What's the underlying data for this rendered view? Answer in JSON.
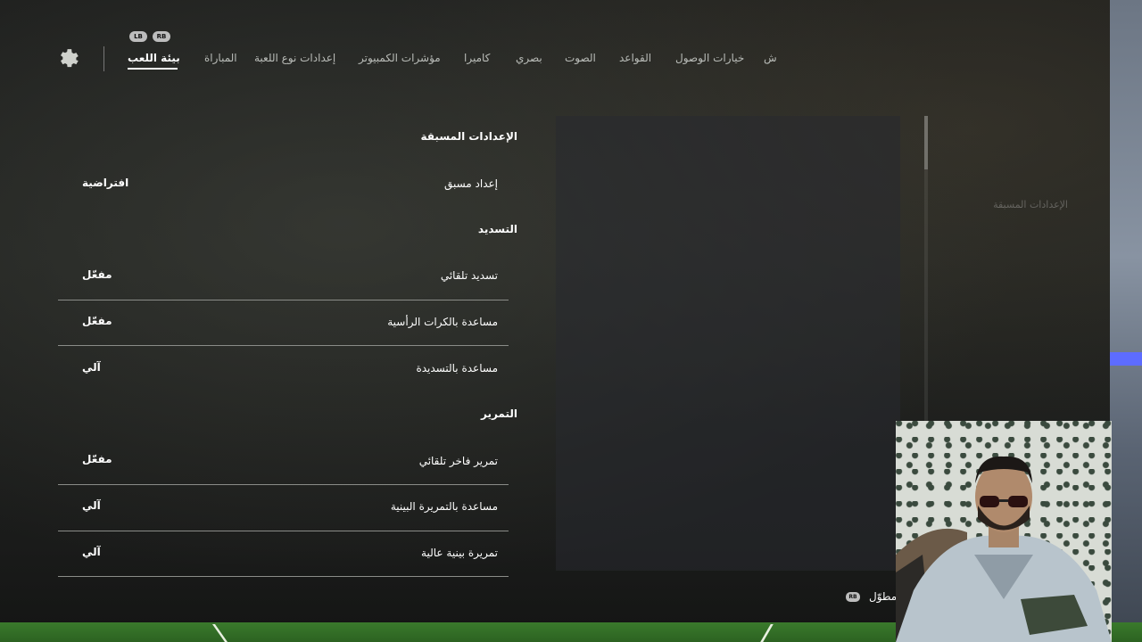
{
  "nav": {
    "bumpers": {
      "left": "LB",
      "right": "RB"
    },
    "tabs": [
      {
        "label": "بيئة اللعب",
        "active": true
      },
      {
        "label": "المباراة"
      },
      {
        "label": "إعدادات نوع اللعبة"
      },
      {
        "label": "مؤشرات الكمبيوتر"
      },
      {
        "label": "كاميرا"
      },
      {
        "label": "بصري"
      },
      {
        "label": "الصوت"
      },
      {
        "label": "القواعد"
      },
      {
        "label": "خيارات الوصول"
      },
      {
        "label": "ش"
      }
    ]
  },
  "sections": {
    "presets": {
      "title": "الإعدادات المسبقة",
      "rows": [
        {
          "label": "إعداد مسبق",
          "value": "افتراضية"
        }
      ]
    },
    "shooting": {
      "title": "التسديد",
      "rows": [
        {
          "label": "تسديد تلقائي",
          "value": "مفعّل"
        },
        {
          "label": "مساعدة بالكرات الرأسية",
          "value": "مفعّل"
        },
        {
          "label": "مساعدة بالتسديدة",
          "value": "آلي"
        }
      ]
    },
    "passing": {
      "title": "التمرير",
      "rows": [
        {
          "label": "تمرير فاخر تلقائي",
          "value": "مفعّل"
        },
        {
          "label": "مساعدة بالتمريرة البينية",
          "value": "آلي"
        },
        {
          "label": "تمريرة بينية عالية",
          "value": "آلي"
        }
      ]
    }
  },
  "faded_sidebar": {
    "title": "الإعدادات المسبقة"
  },
  "hint": {
    "button": "RB",
    "label": "مطوّل"
  },
  "colors": {
    "pitch": "#2c6221",
    "accent_stripe": "#5d6cff"
  }
}
